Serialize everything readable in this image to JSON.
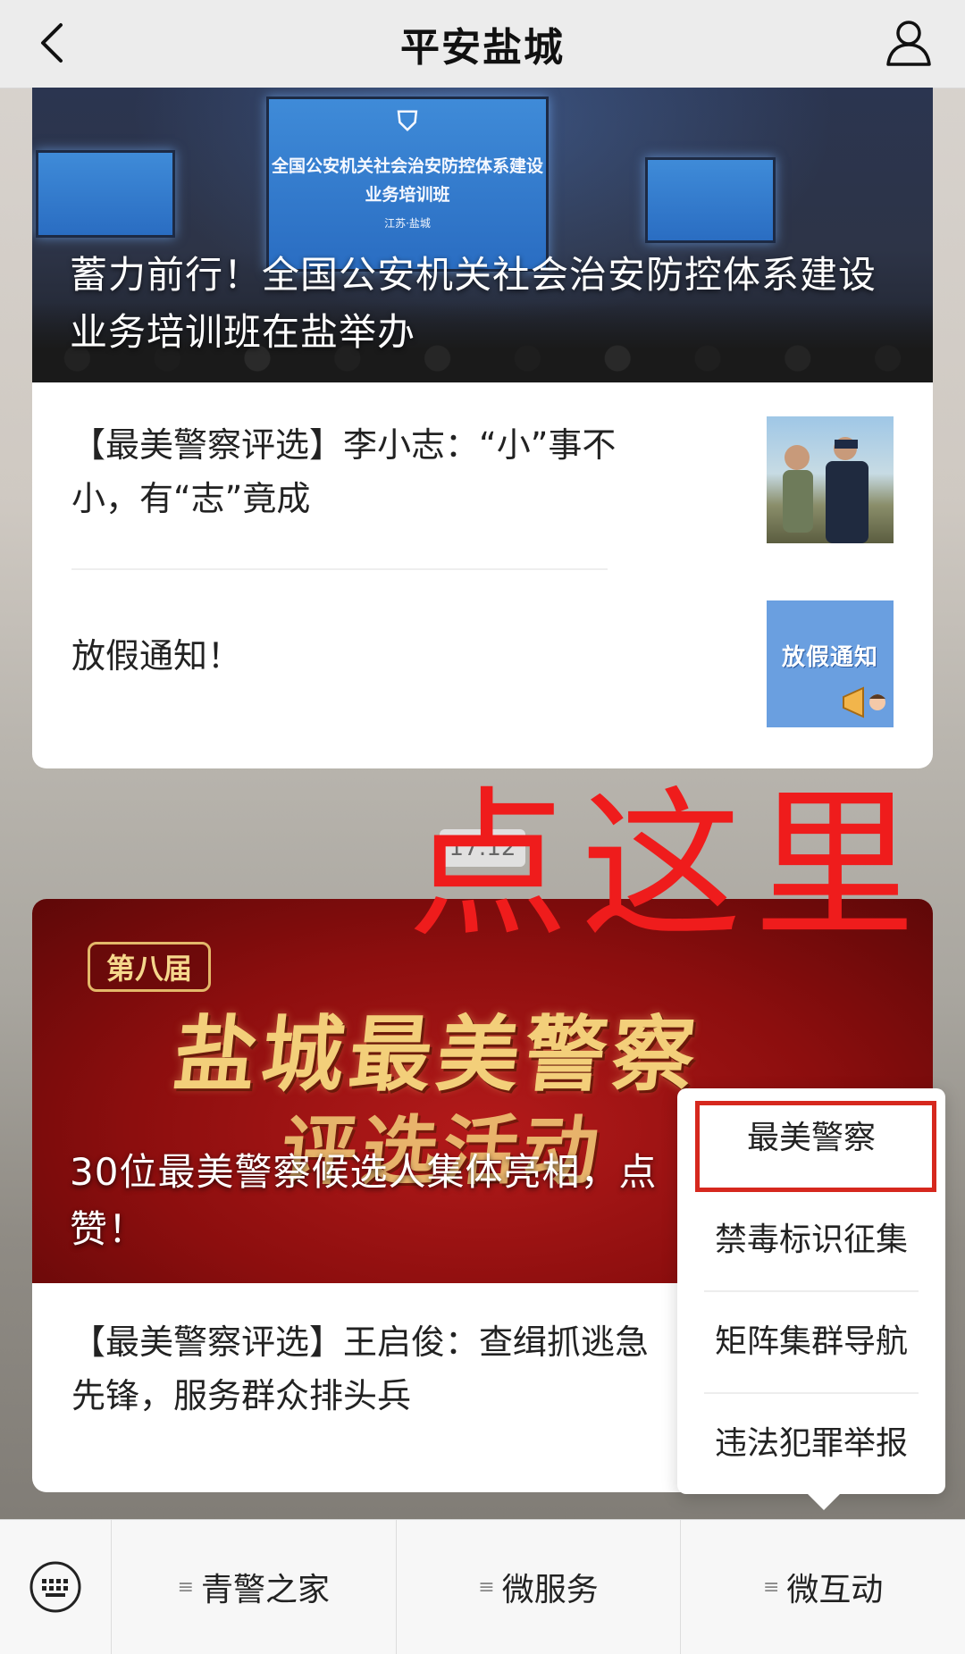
{
  "header": {
    "title": "平安盐城",
    "back_icon": "back-arrow-icon",
    "user_icon": "user-icon"
  },
  "card1": {
    "hero_title": "蓄力前行！全国公安机关社会治安防控体系建设业务培训班在盐举办",
    "screen_main": [
      "全国公安机关社会治安防控体系建设",
      "业务培训班",
      "江苏·盐城"
    ],
    "items": [
      {
        "text": "【最美警察评选】李小志：“小”事不小，有“志”竟成",
        "thumb": "police-photo"
      },
      {
        "text": "放假通知！",
        "thumb": "notice-image",
        "thumb_text": "放假通知"
      }
    ]
  },
  "time": "17:12",
  "annotation": "点这里",
  "card2": {
    "hero_tag": "第八届",
    "hero_big1": "盐城最美警察",
    "hero_big2": "评选活动",
    "hero_title": "30位最美警察候选人集体亮相，点赞！",
    "items": [
      {
        "text": "【最美警察评选】王启俊：查缉抓逃急先锋，服务群众排头兵"
      }
    ]
  },
  "popup": {
    "items": [
      "最美警察",
      "禁毒标识征集",
      "矩阵集群导航",
      "违法犯罪举报"
    ]
  },
  "bottom_bar": {
    "keyboard_icon": "keyboard-icon",
    "tabs": [
      "青警之家",
      "微服务",
      "微互动"
    ]
  }
}
